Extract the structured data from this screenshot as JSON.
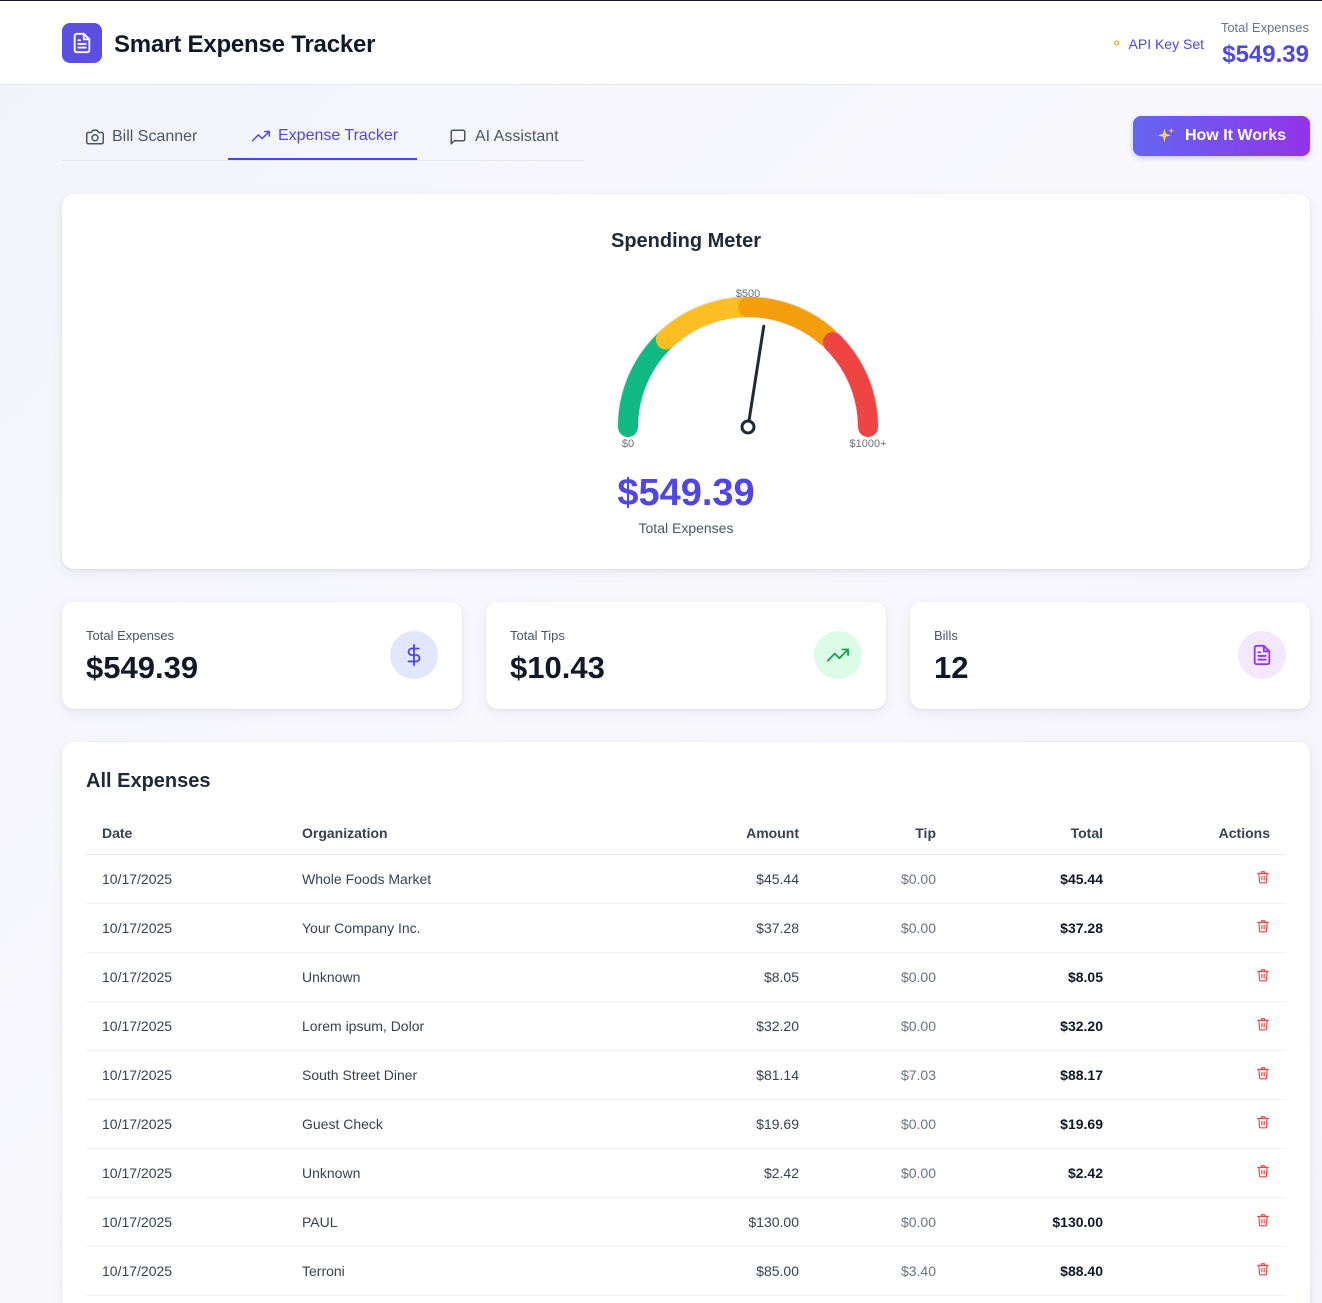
{
  "app": {
    "title": "Smart Expense Tracker",
    "api_status": "API Key Set",
    "header_total_label": "Total Expenses",
    "header_total_value": "$549.39"
  },
  "tabs": [
    {
      "label": "Bill Scanner",
      "icon": "camera-icon",
      "active": false
    },
    {
      "label": "Expense Tracker",
      "icon": "trending-up-icon",
      "active": true
    },
    {
      "label": "AI Assistant",
      "icon": "chat-icon",
      "active": false
    }
  ],
  "how_it_works": {
    "label": "How It Works",
    "icon": "sparkles-icon"
  },
  "meter": {
    "title": "Spending Meter",
    "tick_min": "$0",
    "tick_mid": "$500",
    "tick_max": "$1000+",
    "value": 549.39,
    "max": 1000,
    "value_display": "$549.39",
    "label": "Total Expenses",
    "colors": {
      "low": "#10b981",
      "mid_low": "#fbbf24",
      "mid_high": "#f59e0b",
      "high": "#ef4444"
    }
  },
  "stats": [
    {
      "label": "Total Expenses",
      "value": "$549.39",
      "icon": "dollar-icon",
      "color": "#4f46e5"
    },
    {
      "label": "Total Tips",
      "value": "$10.43",
      "icon": "trending-up-icon",
      "color": "#16a34a"
    },
    {
      "label": "Bills",
      "value": "12",
      "icon": "document-icon",
      "color": "#9333ea"
    }
  ],
  "expenses": {
    "title": "All Expenses",
    "columns": [
      "Date",
      "Organization",
      "Amount",
      "Tip",
      "Total",
      "Actions"
    ],
    "rows": [
      {
        "date": "10/17/2025",
        "org": "Whole Foods Market",
        "amount": "$45.44",
        "tip": "$0.00",
        "total": "$45.44"
      },
      {
        "date": "10/17/2025",
        "org": "Your Company Inc.",
        "amount": "$37.28",
        "tip": "$0.00",
        "total": "$37.28"
      },
      {
        "date": "10/17/2025",
        "org": "Unknown",
        "amount": "$8.05",
        "tip": "$0.00",
        "total": "$8.05"
      },
      {
        "date": "10/17/2025",
        "org": "Lorem ipsum, Dolor",
        "amount": "$32.20",
        "tip": "$0.00",
        "total": "$32.20"
      },
      {
        "date": "10/17/2025",
        "org": "South Street Diner",
        "amount": "$81.14",
        "tip": "$7.03",
        "total": "$88.17"
      },
      {
        "date": "10/17/2025",
        "org": "Guest Check",
        "amount": "$19.69",
        "tip": "$0.00",
        "total": "$19.69"
      },
      {
        "date": "10/17/2025",
        "org": "Unknown",
        "amount": "$2.42",
        "tip": "$0.00",
        "total": "$2.42"
      },
      {
        "date": "10/17/2025",
        "org": "PAUL",
        "amount": "$130.00",
        "tip": "$0.00",
        "total": "$130.00"
      },
      {
        "date": "10/17/2025",
        "org": "Terroni",
        "amount": "$85.00",
        "tip": "$3.40",
        "total": "$88.40"
      }
    ]
  }
}
